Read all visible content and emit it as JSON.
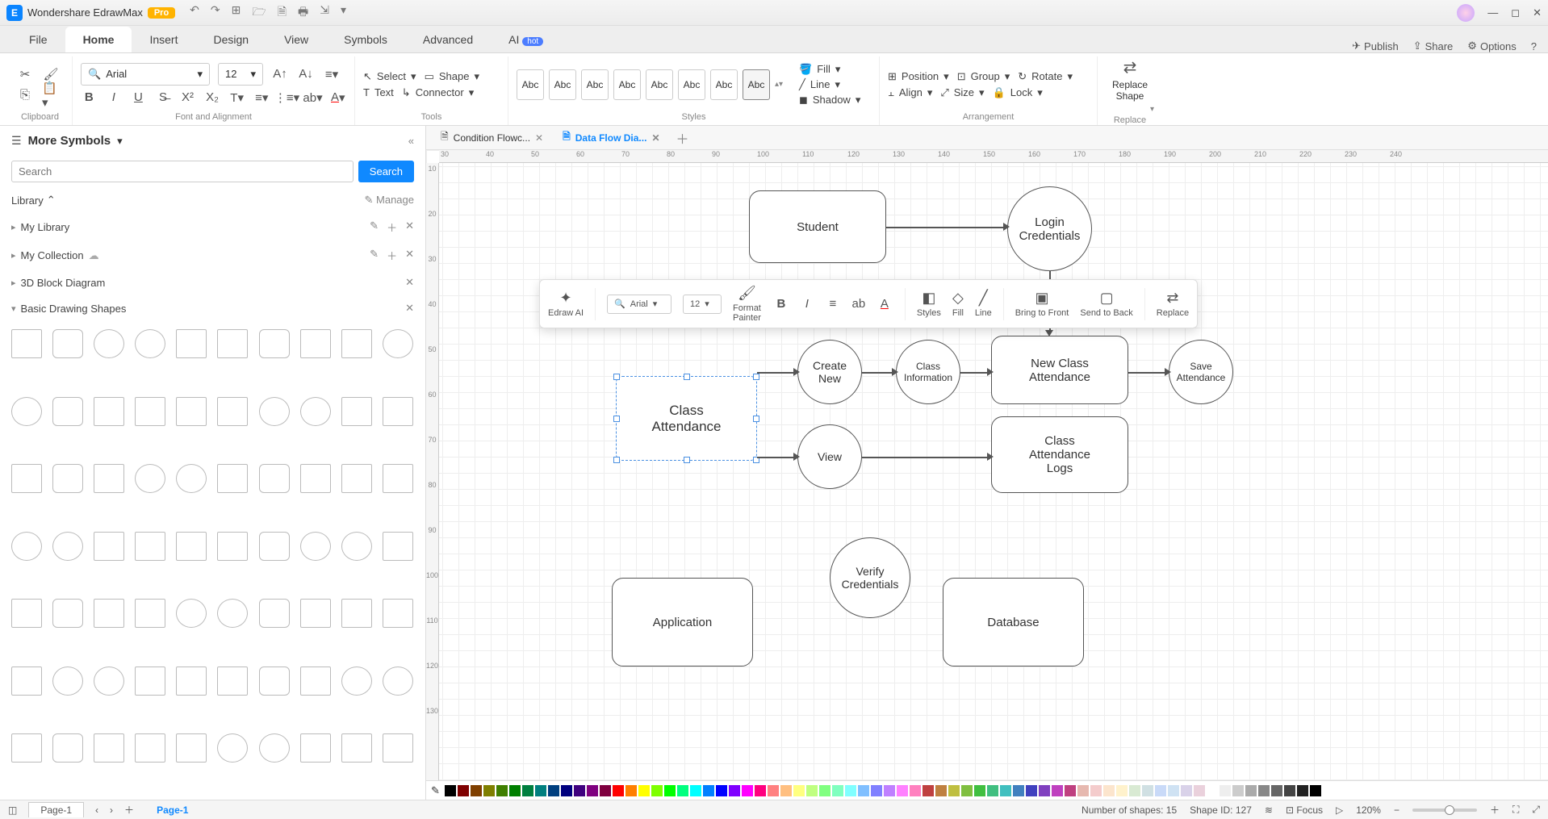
{
  "app": {
    "name": "Wondershare EdrawMax",
    "badge": "Pro"
  },
  "qat": [
    "↶",
    "↷",
    "⊞",
    "🗁",
    "🗎",
    "🖶",
    "⇲",
    "▾"
  ],
  "win": [
    "—",
    "◻",
    "✕"
  ],
  "menu": {
    "tabs": [
      "File",
      "Home",
      "Insert",
      "Design",
      "View",
      "Symbols",
      "Advanced",
      "AI"
    ],
    "active": "Home",
    "hot": "hot",
    "right": {
      "publish": "Publish",
      "share": "Share",
      "options": "Options",
      "help": "?"
    }
  },
  "ribbon": {
    "clipboard": {
      "label": "Clipboard"
    },
    "font": {
      "name": "Arial",
      "size": "12",
      "label": "Font and Alignment"
    },
    "tools": {
      "select": "Select",
      "shape": "Shape",
      "text": "Text",
      "connector": "Connector",
      "label": "Tools"
    },
    "styles": {
      "abc": "Abc",
      "fill": "Fill",
      "line": "Line",
      "shadow": "Shadow",
      "label": "Styles"
    },
    "arrange": {
      "position": "Position",
      "group": "Group",
      "rotate": "Rotate",
      "align": "Align",
      "size": "Size",
      "lock": "Lock",
      "label": "Arrangement"
    },
    "replace": {
      "btn": "Replace\nShape",
      "label": "Replace"
    }
  },
  "leftpanel": {
    "title": "More Symbols",
    "search_ph": "Search",
    "search_btn": "Search",
    "library": "Library",
    "manage": "Manage",
    "groups": [
      "My Library",
      "My Collection",
      "3D Block Diagram",
      "Basic Drawing Shapes"
    ]
  },
  "doctabs": [
    {
      "name": "Condition Flowc...",
      "active": false
    },
    {
      "name": "Data Flow Dia...",
      "active": true
    }
  ],
  "ruler_h": [
    "30",
    "40",
    "50",
    "60",
    "70",
    "80",
    "90",
    "100",
    "110",
    "120",
    "130",
    "140",
    "150",
    "160",
    "170",
    "180",
    "190",
    "200",
    "210",
    "220",
    "230",
    "240"
  ],
  "ruler_v": [
    "10",
    "20",
    "30",
    "40",
    "50",
    "60",
    "70",
    "80",
    "90",
    "100",
    "110",
    "120",
    "130"
  ],
  "nodes": {
    "student": "Student",
    "login": "Login\nCredentials",
    "class_att": "Class\nAttendance",
    "create_new": "Create\nNew",
    "class_info": "Class\nInformation",
    "new_class_att": "New Class\nAttendance",
    "save_att": "Save\nAttendance",
    "view": "View",
    "logs": "Class\nAttendance\nLogs",
    "verify": "Verify\nCredentials",
    "application": "Application",
    "database": "Database"
  },
  "float": {
    "ai": "Edraw AI",
    "font": "Arial",
    "size": "12",
    "fmt": "Format\nPainter",
    "styles": "Styles",
    "fill": "Fill",
    "line": "Line",
    "btf": "Bring to Front",
    "stb": "Send to Back",
    "replace": "Replace"
  },
  "status": {
    "shapes_lbl": "Number of shapes:",
    "shapes": "15",
    "id_lbl": "Shape ID:",
    "id": "127",
    "focus": "Focus",
    "zoom": "120%"
  },
  "pages": {
    "p1": "Page-1",
    "active": "Page-1"
  },
  "swatch_colors": [
    "#000",
    "#7f0000",
    "#7f3f00",
    "#7f7f00",
    "#3f7f00",
    "#007f00",
    "#007f3f",
    "#007f7f",
    "#003f7f",
    "#00007f",
    "#3f007f",
    "#7f007f",
    "#7f003f",
    "#ff0000",
    "#ff7f00",
    "#ffff00",
    "#7fff00",
    "#00ff00",
    "#00ff7f",
    "#00ffff",
    "#007fff",
    "#0000ff",
    "#7f00ff",
    "#ff00ff",
    "#ff007f",
    "#ff8080",
    "#ffbf80",
    "#ffff80",
    "#bfff80",
    "#80ff80",
    "#80ffbf",
    "#80ffff",
    "#80bfff",
    "#8080ff",
    "#bf80ff",
    "#ff80ff",
    "#ff80bf",
    "#bf4040",
    "#bf8040",
    "#bfbf40",
    "#80bf40",
    "#40bf40",
    "#40bf80",
    "#40bfbf",
    "#4080bf",
    "#4040bf",
    "#8040bf",
    "#bf40bf",
    "#bf4080",
    "#e6b8af",
    "#f4cccc",
    "#fce5cd",
    "#fff2cc",
    "#d9ead3",
    "#d0e0e3",
    "#c9daf8",
    "#cfe2f3",
    "#d9d2e9",
    "#ead1dc",
    "#fff",
    "#eee",
    "#ccc",
    "#aaa",
    "#888",
    "#666",
    "#444",
    "#222",
    "#000"
  ]
}
